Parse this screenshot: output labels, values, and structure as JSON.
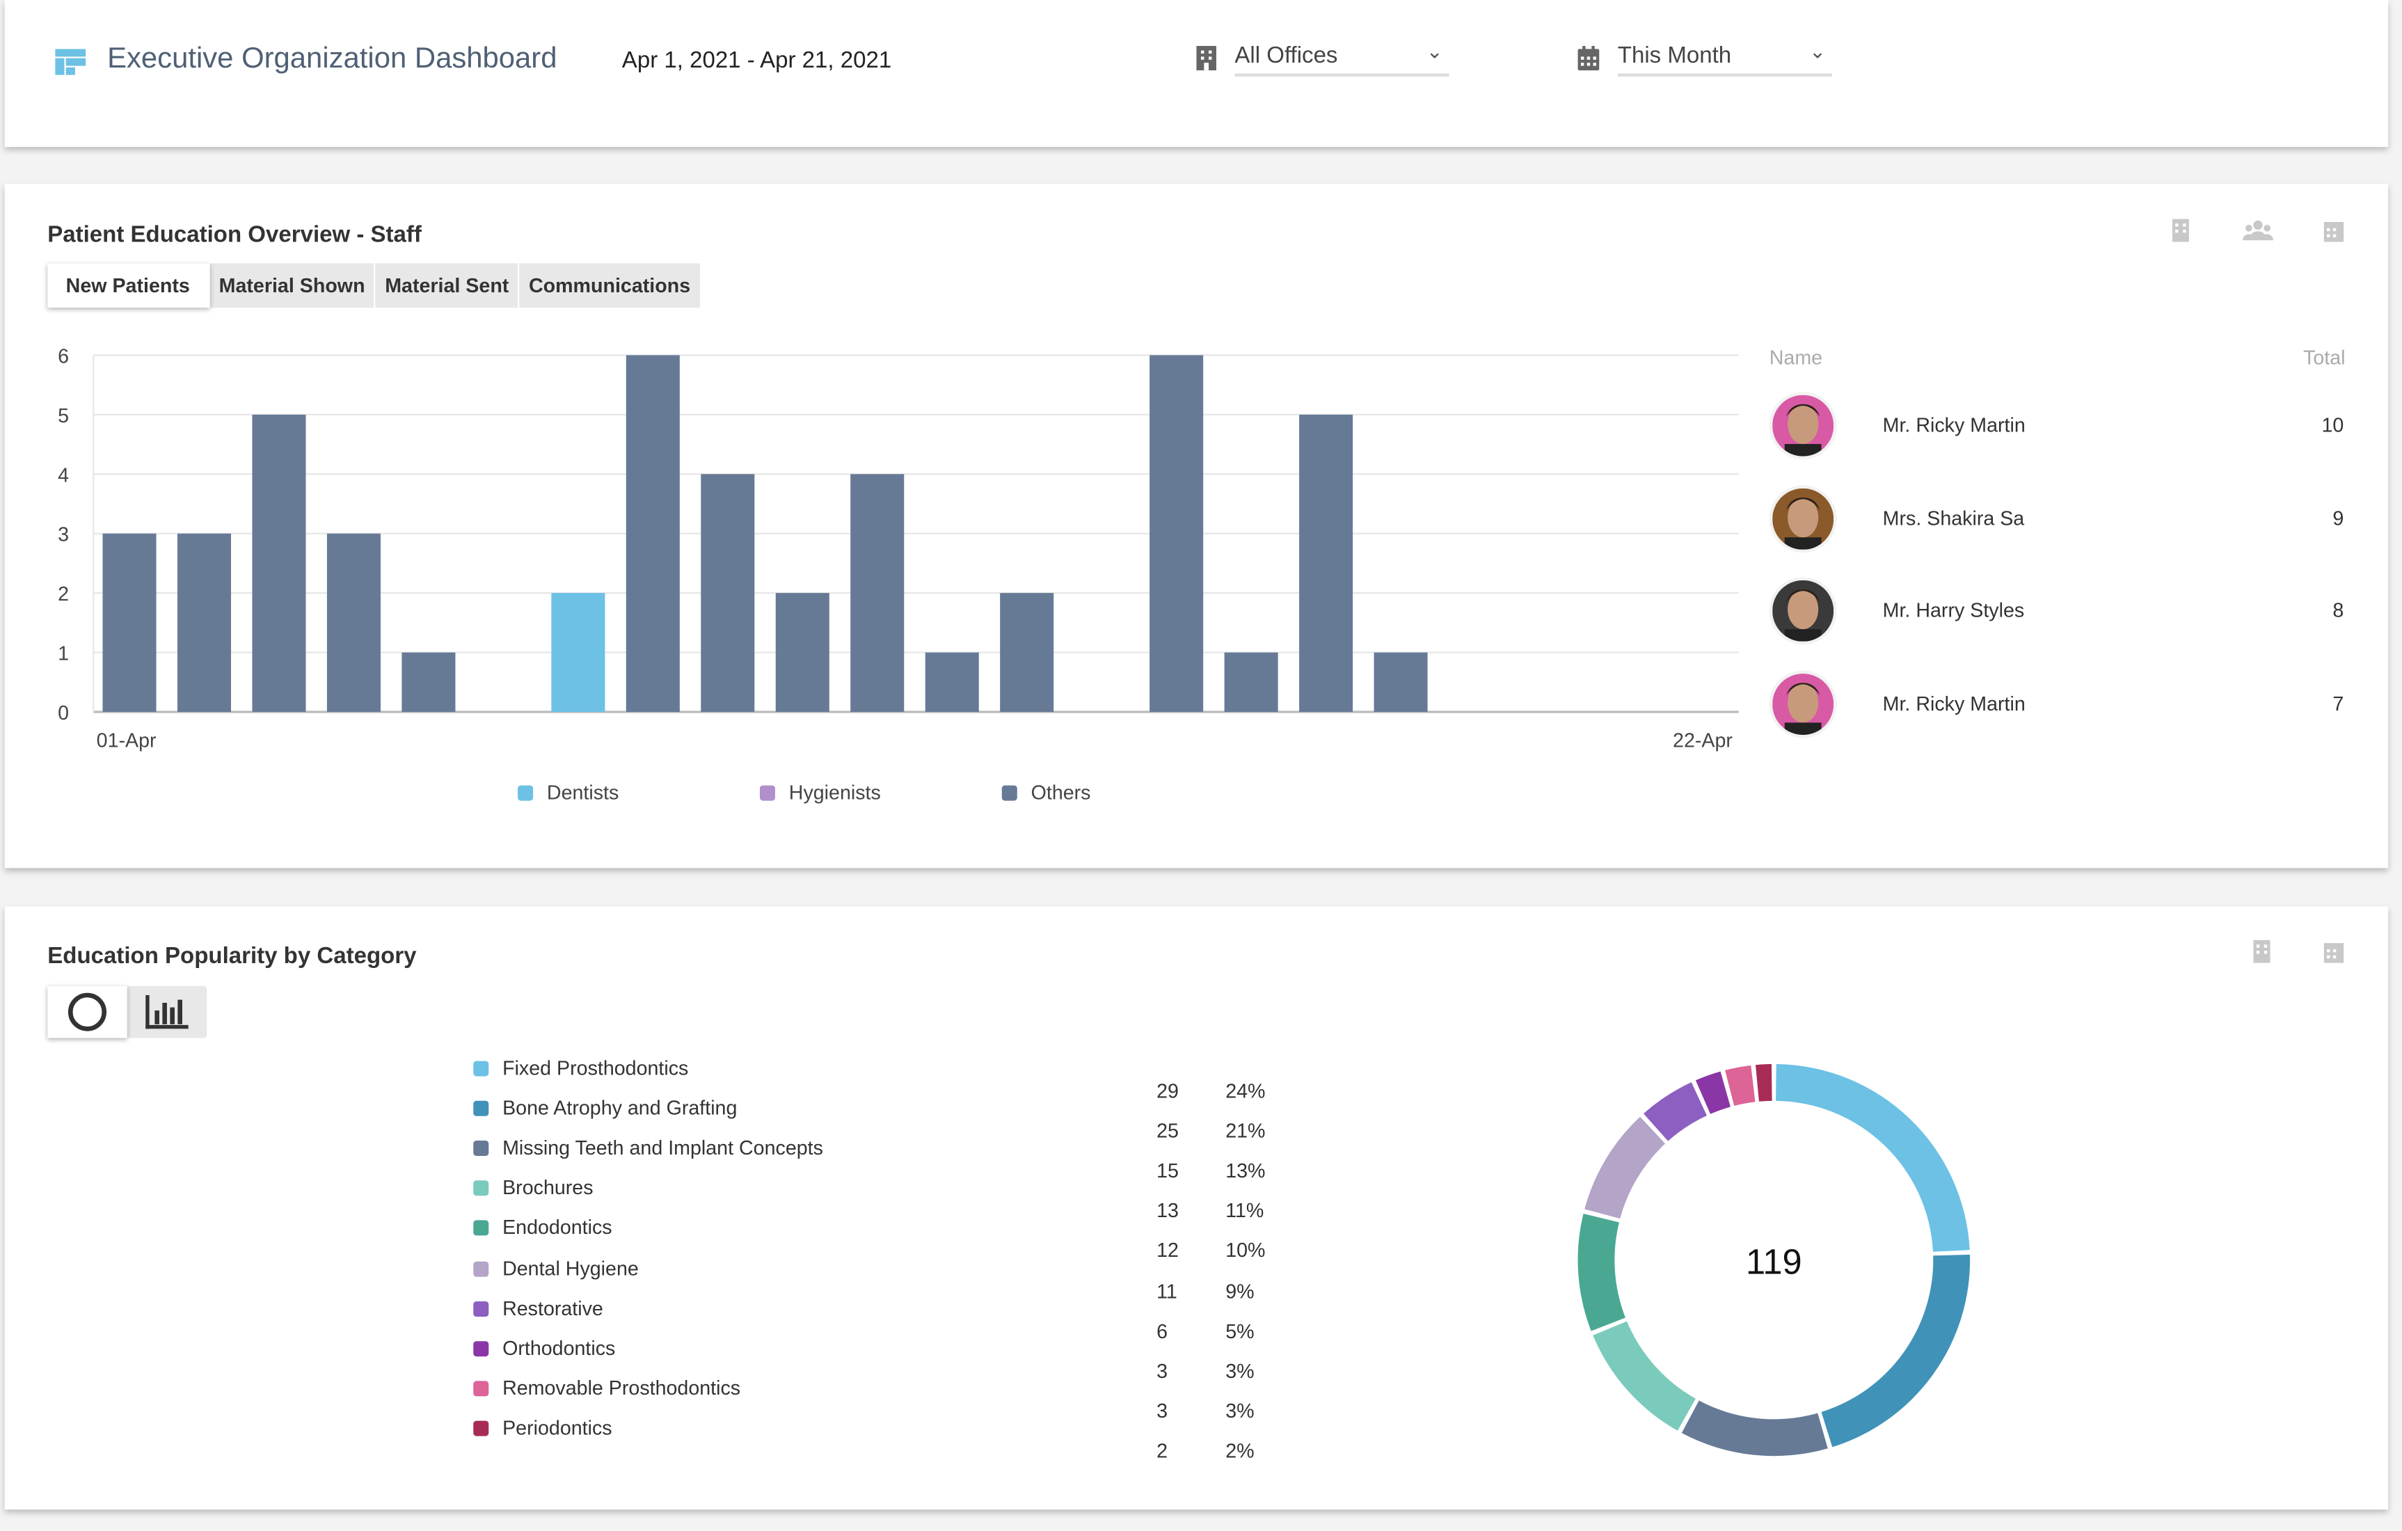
{
  "header": {
    "title": "Executive Organization Dashboard",
    "date_range": "Apr 1, 2021 - Apr 21, 2021",
    "office_select": "All Offices",
    "period_select": "This Month"
  },
  "staff_card": {
    "title": "Patient Education Overview - Staff",
    "tabs": [
      {
        "label": "New Patients",
        "active": true
      },
      {
        "label": "Material Shown"
      },
      {
        "label": "Material Sent"
      },
      {
        "label": "Communications"
      }
    ],
    "list_headers": {
      "name": "Name",
      "total": "Total"
    },
    "staff": [
      {
        "name": "Mr. Ricky Martin",
        "total": "10",
        "avatar_color": "#d85aa5"
      },
      {
        "name": "Mrs. Shakira Sa",
        "total": "9",
        "avatar_color": "#8a5a2a"
      },
      {
        "name": "Mr. Harry Styles",
        "total": "8",
        "avatar_color": "#3a3a3a"
      },
      {
        "name": "Mr. Ricky Martin",
        "total": "7",
        "avatar_color": "#d85aa5"
      }
    ]
  },
  "category_card": {
    "title": "Education Popularity by Category"
  },
  "chart_data": [
    {
      "type": "bar",
      "stacked": true,
      "x_tick_labels": [
        "01-Apr",
        "22-Apr"
      ],
      "categories": [
        "01-Apr",
        "02-Apr",
        "03-Apr",
        "04-Apr",
        "05-Apr",
        "06-Apr",
        "07-Apr",
        "08-Apr",
        "09-Apr",
        "10-Apr",
        "11-Apr",
        "12-Apr",
        "13-Apr",
        "14-Apr",
        "15-Apr",
        "16-Apr",
        "17-Apr",
        "18-Apr",
        "19-Apr",
        "20-Apr",
        "21-Apr",
        "22-Apr"
      ],
      "series": [
        {
          "name": "Dentists",
          "color": "#6cc1e5",
          "values": [
            0,
            0,
            0,
            0,
            0,
            0,
            2,
            0,
            0,
            0,
            0,
            0,
            0,
            0,
            0,
            0,
            0,
            0,
            0,
            0,
            0,
            0
          ]
        },
        {
          "name": "Hygienists",
          "color": "#b08fcc",
          "values": [
            0,
            0,
            0,
            0,
            0,
            0,
            0,
            0,
            0,
            0,
            0,
            0,
            0,
            0,
            0,
            0,
            0,
            0,
            0,
            0,
            0,
            0
          ]
        },
        {
          "name": "Others",
          "color": "#667a96",
          "values": [
            3,
            3,
            5,
            3,
            1,
            0,
            0,
            6,
            4,
            2,
            4,
            1,
            2,
            0,
            6,
            1,
            5,
            1,
            0,
            0,
            0,
            0
          ]
        }
      ],
      "ylim": [
        0,
        6
      ],
      "yticks": [
        0,
        1,
        2,
        3,
        4,
        5,
        6
      ],
      "grid": true,
      "legend": "bottom"
    },
    {
      "type": "pie",
      "donut": true,
      "center_label": "119",
      "slices": [
        {
          "label": "Fixed Prosthodontics",
          "value": 29,
          "pct": "24%",
          "color": "#6cc1e5"
        },
        {
          "label": "Bone Atrophy and Grafting",
          "value": 25,
          "pct": "21%",
          "color": "#4192b8"
        },
        {
          "label": "Missing Teeth and Implant Concepts",
          "value": 15,
          "pct": "13%",
          "color": "#667a96"
        },
        {
          "label": "Brochures",
          "value": 13,
          "pct": "11%",
          "color": "#7acbbb"
        },
        {
          "label": "Endodontics",
          "value": 12,
          "pct": "10%",
          "color": "#4aa892"
        },
        {
          "label": "Dental Hygiene",
          "value": 11,
          "pct": "9%",
          "color": "#b4a4c8"
        },
        {
          "label": "Restorative",
          "value": 6,
          "pct": "5%",
          "color": "#8c5fc1"
        },
        {
          "label": "Orthodontics",
          "value": 3,
          "pct": "3%",
          "color": "#8b36a6"
        },
        {
          "label": "Removable Prosthodontics",
          "value": 3,
          "pct": "3%",
          "color": "#dc6496"
        },
        {
          "label": "Periodontics",
          "value": 2,
          "pct": "2%",
          "color": "#a82b56"
        }
      ]
    }
  ]
}
